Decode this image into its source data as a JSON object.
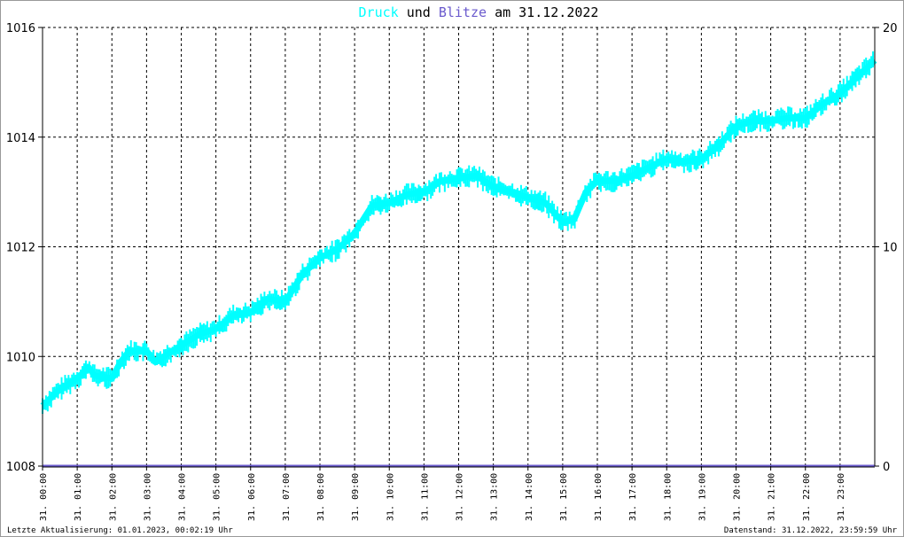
{
  "chart_data": {
    "type": "line",
    "title_parts": {
      "series1": "Druck",
      "und": "und",
      "series2": "Blitze",
      "rest": "am 31.12.2022"
    },
    "colors": {
      "druck": "#00ffff",
      "blitze": "#6a5acd",
      "grid": "#000000",
      "axis": "#000000",
      "frame": "#999999"
    },
    "y_left": {
      "range": [
        1008,
        1016
      ],
      "ticks": [
        "1008",
        "1010",
        "1012",
        "1014",
        "1016"
      ]
    },
    "y_right": {
      "range": [
        0,
        20
      ],
      "ticks": [
        "0",
        "10",
        "20"
      ]
    },
    "x_ticks": [
      "31. 00:00",
      "31. 01:00",
      "31. 02:00",
      "31. 03:00",
      "31. 04:00",
      "31. 05:00",
      "31. 06:00",
      "31. 07:00",
      "31. 08:00",
      "31. 09:00",
      "31. 10:00",
      "31. 11:00",
      "31. 12:00",
      "31. 13:00",
      "31. 14:00",
      "31. 15:00",
      "31. 16:00",
      "31. 17:00",
      "31. 18:00",
      "31. 19:00",
      "31. 20:00",
      "31. 21:00",
      "31. 22:00",
      "31. 23:00"
    ],
    "series": [
      {
        "name": "Druck",
        "x_hours": [
          0,
          0.5,
          1,
          1.33,
          1.5,
          2,
          2.25,
          2.5,
          3,
          3.25,
          3.5,
          4,
          4.5,
          5,
          5.5,
          6,
          6.5,
          7,
          7.5,
          8,
          8.5,
          9,
          9.5,
          10,
          10.5,
          11,
          11.5,
          12,
          12.5,
          13,
          13.5,
          14,
          14.5,
          15,
          15.33,
          15.67,
          16,
          16.5,
          17,
          17.5,
          18,
          18.5,
          19,
          19.5,
          20,
          20.5,
          21,
          21.5,
          22,
          22.5,
          23,
          23.5,
          24
        ],
        "values": [
          1009.1,
          1009.4,
          1009.6,
          1009.8,
          1009.65,
          1009.6,
          1009.9,
          1010.1,
          1010.1,
          1009.9,
          1010.0,
          1010.2,
          1010.4,
          1010.5,
          1010.75,
          1010.8,
          1011.05,
          1011.0,
          1011.5,
          1011.8,
          1011.95,
          1012.25,
          1012.75,
          1012.8,
          1012.95,
          1013.0,
          1013.2,
          1013.25,
          1013.3,
          1013.1,
          1013.0,
          1012.9,
          1012.8,
          1012.45,
          1012.5,
          1013.0,
          1013.2,
          1013.2,
          1013.3,
          1013.45,
          1013.6,
          1013.55,
          1013.6,
          1013.85,
          1014.2,
          1014.3,
          1014.3,
          1014.35,
          1014.35,
          1014.6,
          1014.8,
          1015.1,
          1015.4
        ]
      },
      {
        "name": "Blitze",
        "x_hours": [
          0,
          24
        ],
        "values": [
          0,
          0
        ]
      }
    ]
  },
  "footer": {
    "left": "Letzte Aktualisierung: 01.01.2023, 00:02:19 Uhr",
    "right": "Datenstand: 31.12.2022, 23:59:59 Uhr"
  }
}
